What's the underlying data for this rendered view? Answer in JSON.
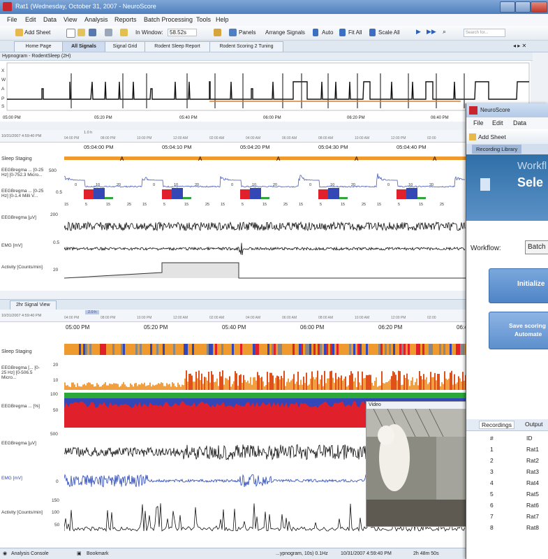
{
  "main_window": {
    "title": "Rat1 (Wednesday, October 31, 2007 - NeuroScore",
    "menu": [
      "File",
      "Edit",
      "Data",
      "View",
      "Analysis",
      "Reports",
      "Batch Processing",
      "Tools",
      "Help"
    ],
    "toolbar": {
      "add_sheet": "Add Sheet",
      "in_window_label": "In Window:",
      "in_window_value": "58.52s",
      "panels": "Panels",
      "arrange_signals": "Arrange Signals",
      "auto": "Auto",
      "fit_all": "Fit All",
      "scale_all": "Scale All",
      "search_placeholder": "Search for..."
    },
    "tabs": [
      "Home Page",
      "All Signals",
      "Signal Grid",
      "Rodent Sleep Report",
      "Rodent Scoring 2 Tuning"
    ],
    "active_tab": "All Signals",
    "hypnogram": {
      "title": "Hypnogram - RodentSleep (2H)",
      "stage_labels": [
        "X",
        "W",
        "A",
        "P",
        "S",
        "E"
      ],
      "times": [
        "05:00 PM",
        "05:20 PM",
        "05:40 PM",
        "06:00 PM",
        "06:20 PM",
        "06:40 PM"
      ]
    },
    "upper_view": {
      "date_label": "10/31/2007 4:59:40 PM",
      "window_label": "1.0 h",
      "overview_times": [
        "04:00 PM",
        "08:00 PM",
        "10:00 PM",
        "12:00 AM",
        "02:00 AM",
        "04:00 AM",
        "06:00 AM",
        "08:00 AM",
        "10:00 AM",
        "12:00 PM",
        "02:00"
      ],
      "times": [
        "05:04:00 PM",
        "05:04:10 PM",
        "05:04:20 PM",
        "05:04:30 PM",
        "05:04:40 PM"
      ],
      "channels": [
        {
          "label": "Sleep Staging"
        },
        {
          "label": "EEGBregma ... [0-25 Hz] [0-752.3 Micro...",
          "scale": "500"
        },
        {
          "label": "EEGBregma ... [0-25 Hz] [0-1.4 Milli V...",
          "scale": "0.5"
        },
        {
          "label": "EEGBregma [µV]",
          "scale": "200"
        },
        {
          "label": "EMG [mV]",
          "scale": "0.5"
        },
        {
          "label": "Activity [Counts/min]",
          "scale": "20"
        }
      ],
      "stage_marker": "A",
      "freq_ticks": [
        "15",
        "0",
        "5",
        "10",
        "15",
        "20",
        "25"
      ]
    },
    "lower_view": {
      "title": "2hr Signal View",
      "date_label": "10/31/2007 4:59:40 PM",
      "window_label": "2.0 h",
      "overview_times": [
        "04:00 PM",
        "08:00 PM",
        "10:00 PM",
        "12:00 AM",
        "02:00 AM",
        "04:00 AM",
        "06:00 AM",
        "08:00 AM",
        "10:00 AM",
        "12:00 PM",
        "02:00"
      ],
      "times": [
        "05:00 PM",
        "05:20 PM",
        "05:40 PM",
        "06:00 PM",
        "06:20 PM",
        "06:4"
      ],
      "channels": [
        {
          "label": "Sleep Staging"
        },
        {
          "label": "EEGBregma [... [0-25 Hz] [0-506.5 Micro...",
          "scale": "20",
          "scale2": "10"
        },
        {
          "label": "EEGBregma ... [%]",
          "scale": "100",
          "scale2": "50"
        },
        {
          "label": "EEGBregma [µV]",
          "scale": "500"
        },
        {
          "label": "EMG [mV]",
          "scale": "0"
        },
        {
          "label": "Activity [Counts/min]",
          "scale": "150",
          "scale2": "100",
          "scale3": "50"
        }
      ],
      "video_label": "Video"
    },
    "status": {
      "analysis_console": "Analysis Console",
      "bookmark": "Bookmark",
      "info": "...ypnogram, 10s) 0.1Hz",
      "datetime": "10/31/2007 4:59:40 PM",
      "duration": "2h 48m 50s"
    }
  },
  "front_window": {
    "title": "NeuroScore",
    "menu": [
      "File",
      "Edit",
      "Data"
    ],
    "add_sheet": "Add Sheet",
    "tab": "Recording Library",
    "workflow_heading": "Workfl",
    "select_heading": "Sele",
    "workflow_label": "Workflow:",
    "workflow_value": "Batch",
    "initialize_button": "Initialize",
    "save_button_line1": "Save scoring",
    "save_button_line2": "Automate",
    "tabs": [
      "Recordings",
      "Output"
    ],
    "table": {
      "headers": [
        "#",
        "ID"
      ],
      "rows": [
        [
          "1",
          "Rat1"
        ],
        [
          "2",
          "Rat2"
        ],
        [
          "3",
          "Rat3"
        ],
        [
          "4",
          "Rat4"
        ],
        [
          "5",
          "Rat5"
        ],
        [
          "6",
          "Rat6"
        ],
        [
          "7",
          "Rat7"
        ],
        [
          "8",
          "Rat8"
        ]
      ]
    }
  }
}
